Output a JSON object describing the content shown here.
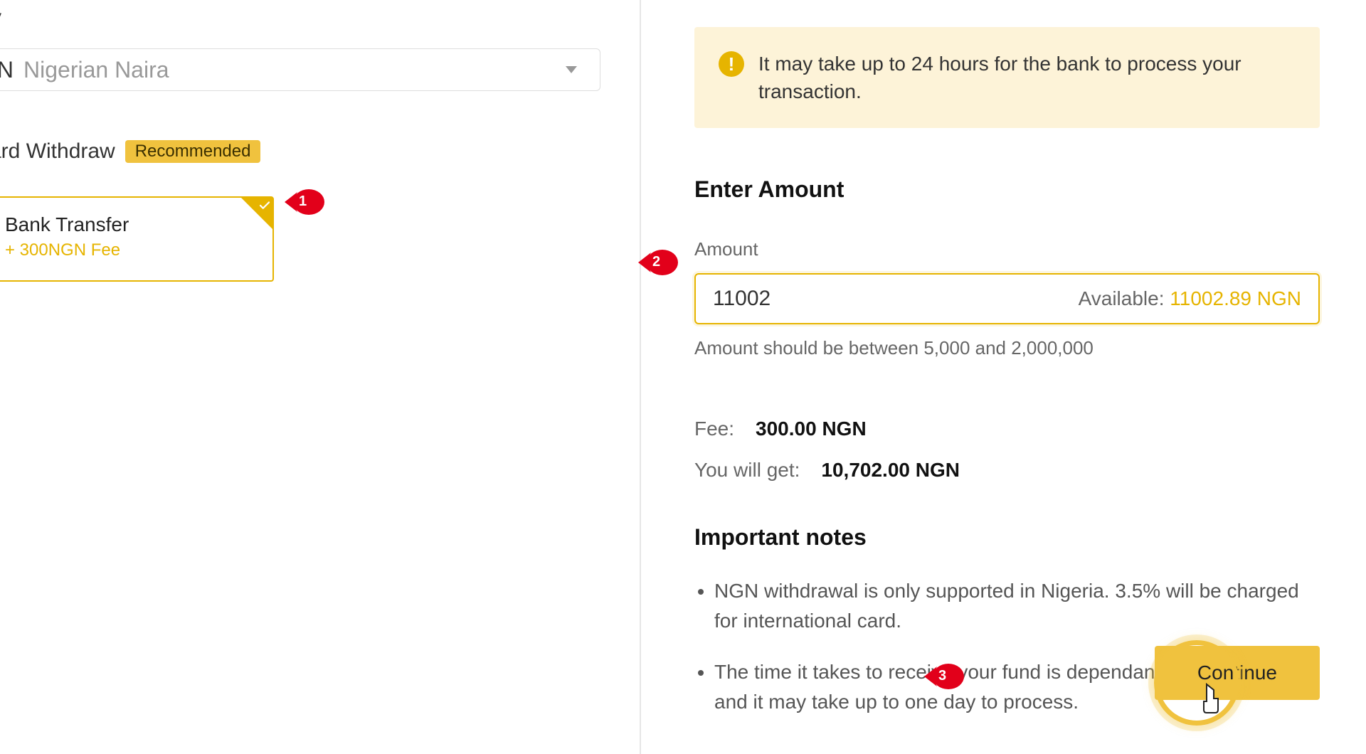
{
  "currency": {
    "label_fragment": "y",
    "code": "GN",
    "name": "Nigerian Naira"
  },
  "section": {
    "card_withdraw": "ard Withdraw",
    "recommended": "Recommended"
  },
  "method": {
    "name": "Bank Transfer",
    "fee": "+ 300NGN Fee"
  },
  "alert": "It may take up to 24 hours for the bank to process your transaction.",
  "amount_section": {
    "title": "Enter Amount",
    "label": "Amount",
    "value": "11002",
    "available_lbl": "Available: ",
    "available_val": "11002.89 NGN",
    "hint": "Amount should be between 5,000 and 2,000,000"
  },
  "fee": {
    "label": "Fee:",
    "value": "300.00 NGN"
  },
  "youget": {
    "label": "You will get:",
    "value": "10,702.00 NGN"
  },
  "notes": {
    "title": "Important notes",
    "items": [
      "NGN withdrawal is only supported in Nigeria. 3.5% will be charged for international card.",
      "The time it takes to receive your fund is dependant on your bank and it may take up to one day to process."
    ]
  },
  "continue": "Continue",
  "markers": {
    "m1": "1",
    "m2": "2",
    "m3": "3"
  }
}
